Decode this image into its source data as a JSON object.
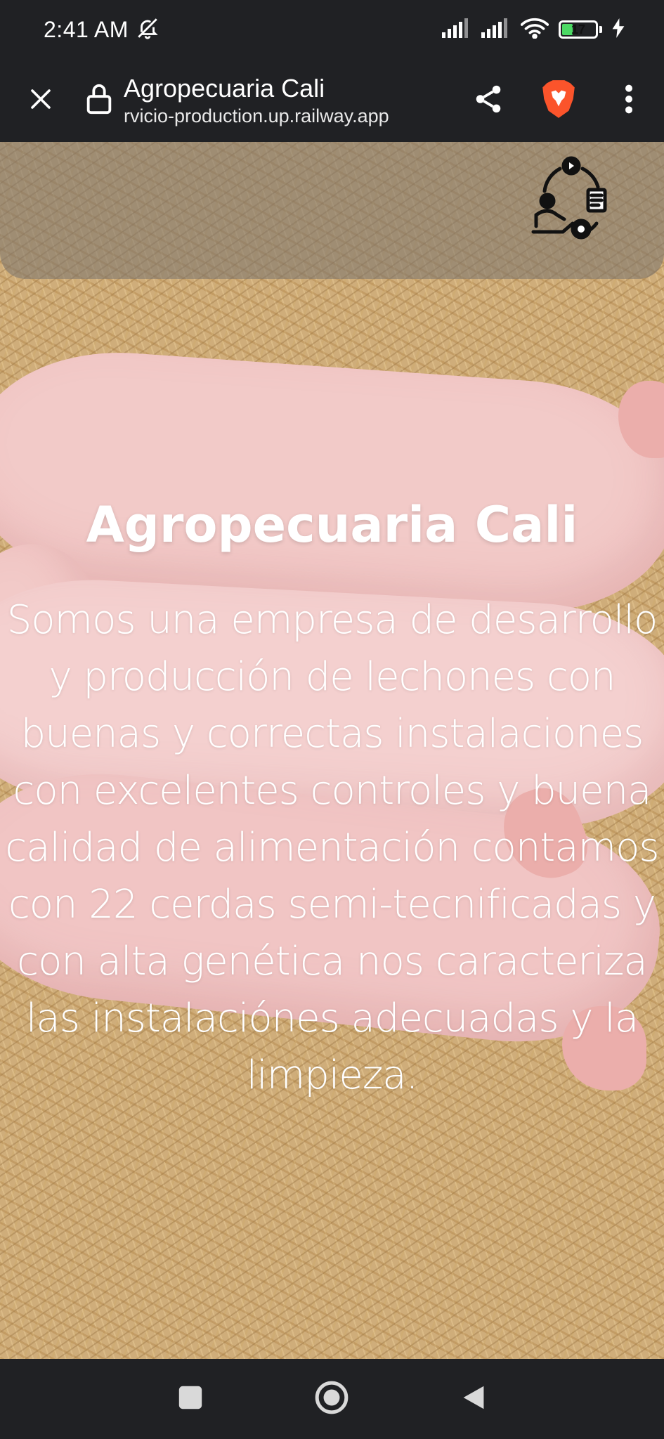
{
  "status_bar": {
    "time": "2:41 AM",
    "battery_level": "17",
    "icons": [
      "bell-off-icon",
      "signal-icon",
      "signal-icon",
      "wifi-icon",
      "battery-icon",
      "charging-icon"
    ]
  },
  "browser": {
    "page_title": "Agropecuaria Cali",
    "url": "rvicio-production.up.railway.app",
    "icons": [
      "close-icon",
      "lock-icon",
      "share-icon",
      "brave-lion-icon",
      "more-vert-icon"
    ],
    "brand_color": "#fb542b"
  },
  "hero": {
    "title": "Agropecuaria Cali",
    "description": "Somos una empresa de desarrollo y producción de lechones con buenas y correctas instalaciones con excelentes controles y buena calidad de alimentación contamos con 22 cerdas semi-tecnificadas y con alta genética nos caracteriza las instalaciónes adecuadas y la limpieza.",
    "logo_icon": "process-logo-icon"
  },
  "navigation": {
    "icons": [
      "recents-square-icon",
      "home-circle-icon",
      "back-triangle-icon"
    ]
  }
}
